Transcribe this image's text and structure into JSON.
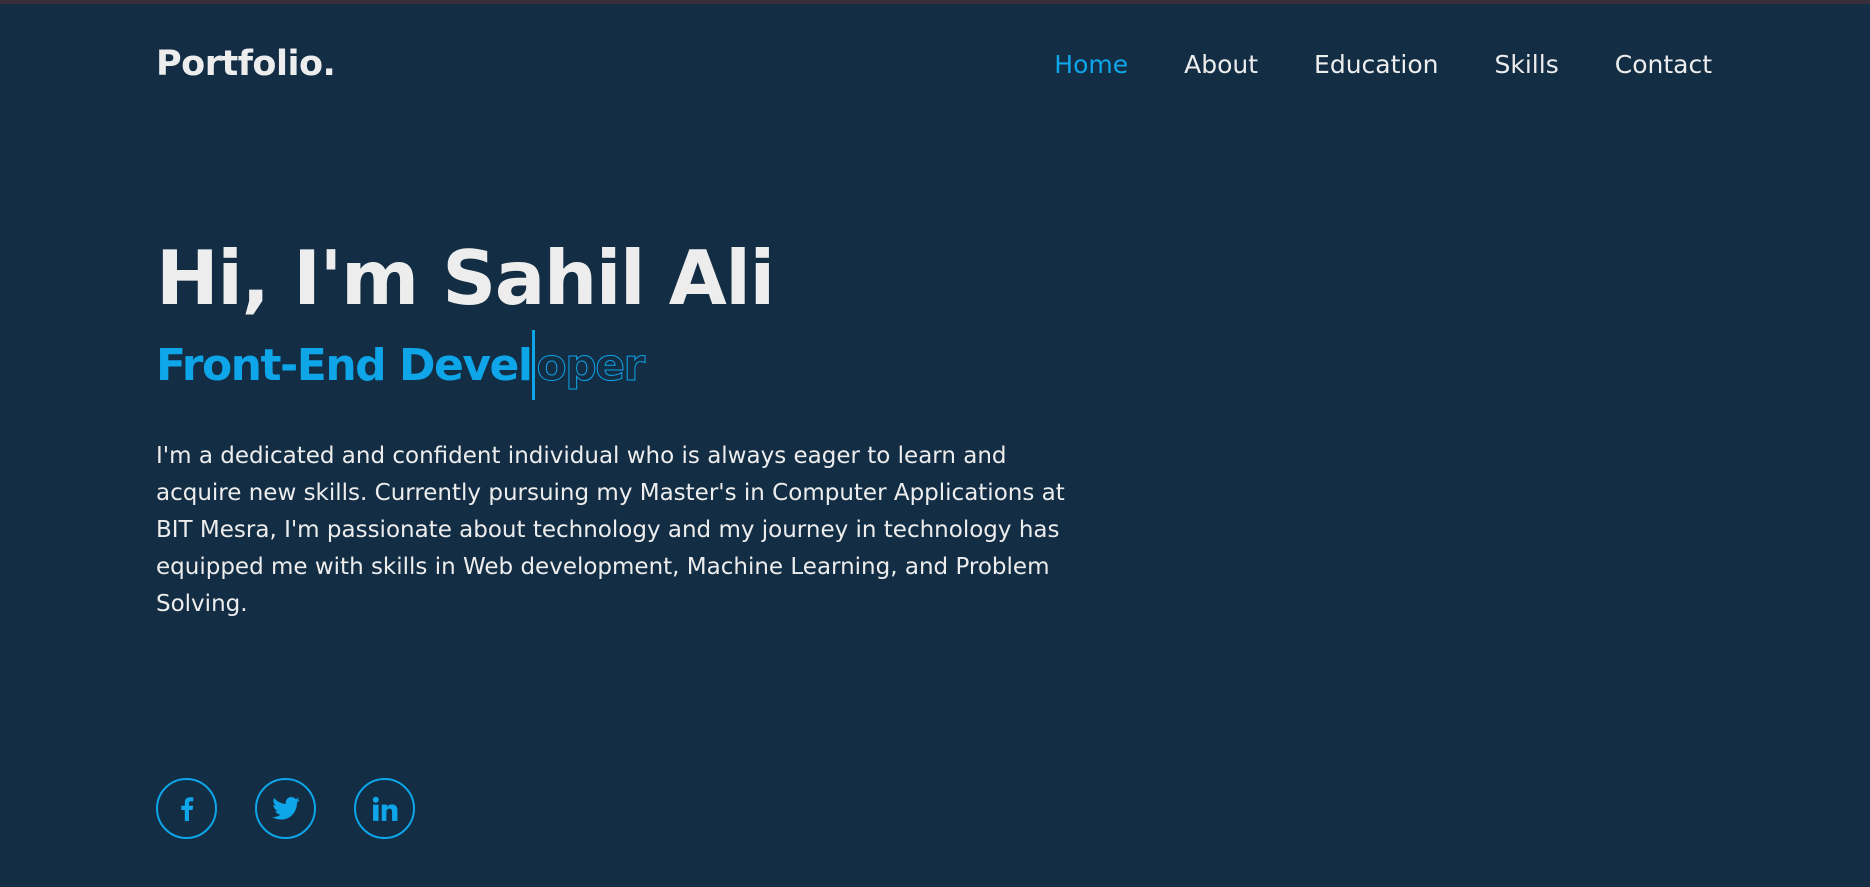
{
  "header": {
    "logo": "Portfolio.",
    "nav": [
      {
        "label": "Home",
        "active": true
      },
      {
        "label": "About",
        "active": false
      },
      {
        "label": "Education",
        "active": false
      },
      {
        "label": "Skills",
        "active": false
      },
      {
        "label": "Contact",
        "active": false
      }
    ]
  },
  "hero": {
    "title": "Hi, I'm Sahil Ali",
    "role_typed": "Front-End Devel",
    "role_remaining": "oper",
    "intro": "I'm a dedicated and confident individual who is always eager to learn and acquire new skills. Currently pursuing my Master's in Computer Applications at BIT Mesra, I'm passionate about technology and my journey in technology has equipped me with skills in Web development, Machine Learning, and Problem Solving."
  },
  "socials": [
    {
      "icon": "facebook-icon"
    },
    {
      "icon": "twitter-icon"
    },
    {
      "icon": "linkedin-icon"
    }
  ],
  "colors": {
    "background": "#122d44",
    "accent": "#0ea5e9",
    "text": "#ededed"
  }
}
